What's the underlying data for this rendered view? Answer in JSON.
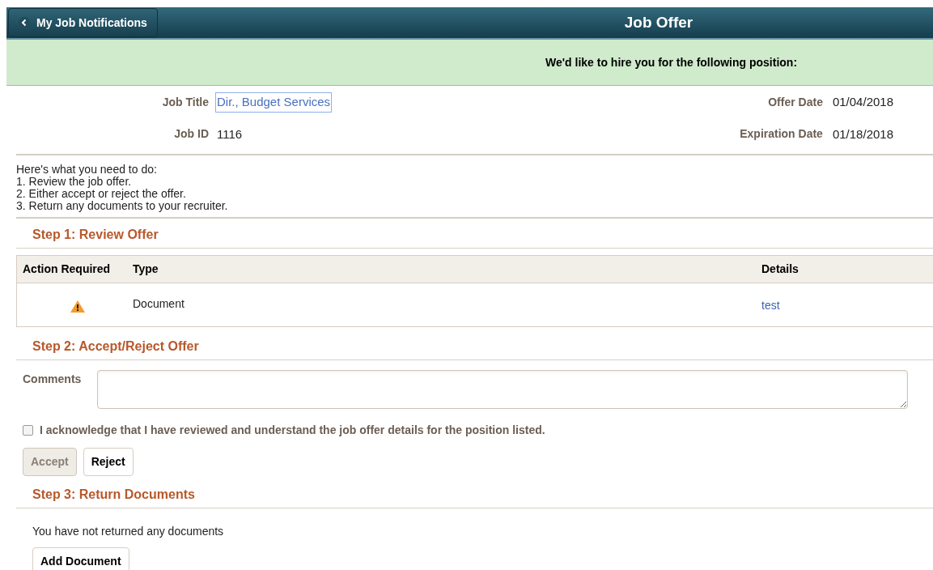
{
  "header": {
    "back_button": "My Job Notifications",
    "title": "Job Offer"
  },
  "banner": "We'd like to hire you for the following position:",
  "fields_left": [
    {
      "label": "Job Title",
      "value": "Dir., Budget Services",
      "kind": "link",
      "focused": true
    },
    {
      "label": "Job ID",
      "value": "1116",
      "kind": "text",
      "focused": false
    }
  ],
  "fields_right": [
    {
      "label": "Offer Date",
      "value": "01/04/2018"
    },
    {
      "label": "Expiration Date",
      "value": "01/18/2018"
    }
  ],
  "instructions": [
    "Here's what you need to do:",
    "1. Review the job offer.",
    "2. Either accept or reject the offer.",
    "3. Return any documents to your recruiter."
  ],
  "step1": {
    "heading": "Step 1: Review Offer",
    "table": {
      "columns": [
        "Action Required",
        "Type",
        "Details"
      ],
      "rows": [
        {
          "action_required": true,
          "type": "Document",
          "details": "test"
        }
      ]
    }
  },
  "step2": {
    "heading": "Step 2: Accept/Reject Offer",
    "comments_label": "Comments",
    "acknowledge": {
      "label": "I acknowledge that I have reviewed and understand the job offer details for the position listed.",
      "checked": false
    },
    "buttons": [
      {
        "label": "Accept",
        "disabled": true
      },
      {
        "label": "Reject",
        "disabled": false
      }
    ]
  },
  "step3": {
    "heading": "Step 3: Return Documents",
    "message": "You have not returned any documents",
    "button": "Add Document"
  }
}
